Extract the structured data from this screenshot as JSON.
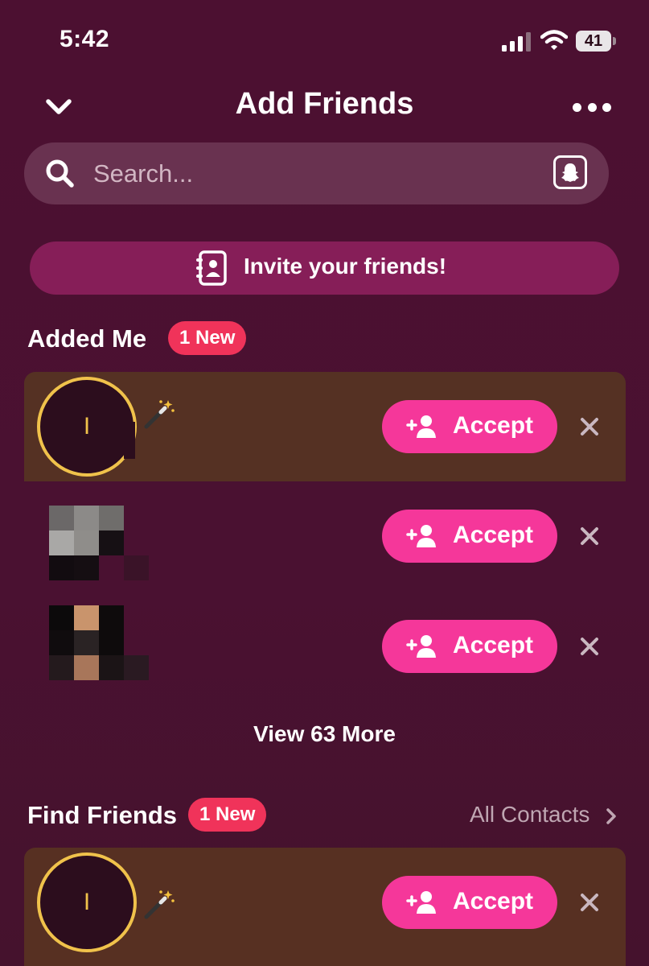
{
  "status_bar": {
    "time": "5:42",
    "battery": "41"
  },
  "header": {
    "title": "Add Friends"
  },
  "search": {
    "placeholder": "Search..."
  },
  "invite": {
    "label": "Invite your friends!"
  },
  "added_me": {
    "title": "Added Me",
    "badge": "1 New",
    "rows": [
      {
        "avatar_initial": "I",
        "accept_label": "Accept"
      },
      {
        "accept_label": "Accept"
      },
      {
        "accept_label": "Accept"
      }
    ],
    "view_more": "View 63 More"
  },
  "find_friends": {
    "title": "Find Friends",
    "badge": "1 New",
    "all_contacts": "All Contacts",
    "rows": [
      {
        "avatar_initial": "I",
        "accept_label": "Accept"
      }
    ]
  },
  "colors": {
    "background": "#4a1130",
    "accent_pink": "#f5379a",
    "badge_red": "#f0335a",
    "invite_bg": "#861e58",
    "highlight_row": "#553123",
    "story_ring": "#f0c24b"
  },
  "icons": {
    "back": "chevron-down-icon",
    "more": "more-dots-icon",
    "search": "search-icon",
    "ghost": "snapcode-ghost-icon",
    "contacts": "contact-book-icon",
    "accept": "add-friend-icon",
    "dismiss": "close-icon",
    "wand": "magic-wand-icon"
  }
}
